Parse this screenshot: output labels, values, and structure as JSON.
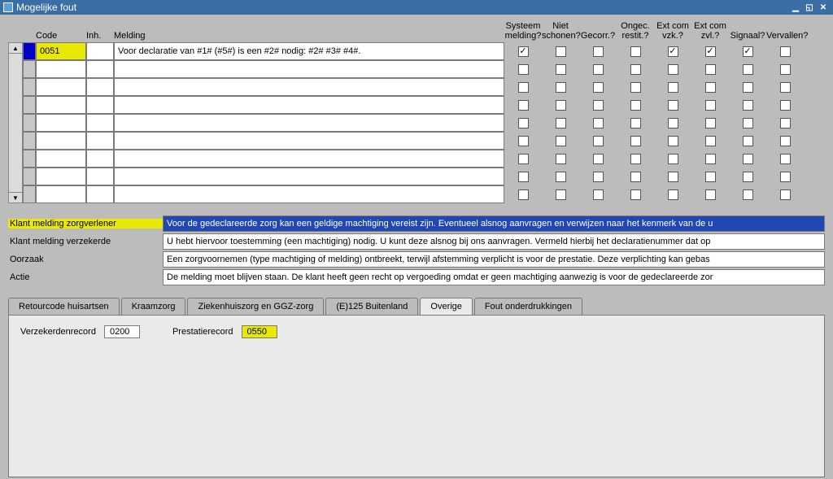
{
  "window": {
    "title": "Mogelijke fout"
  },
  "table": {
    "headers": {
      "code": "Code",
      "inh": "Inh.",
      "melding": "Melding",
      "c1a": "Systeem",
      "c1b": "melding?",
      "c2a": "Niet",
      "c2b": "schonen?",
      "c3a": "",
      "c3b": "Gecorr.?",
      "c4a": "Ongec.",
      "c4b": "restit.?",
      "c5a": "Ext com",
      "c5b": "vzk.?",
      "c6a": "Ext com",
      "c6b": "zvl.?",
      "c7a": "",
      "c7b": "Signaal?",
      "c8a": "",
      "c8b": "Vervallen?"
    },
    "rows": [
      {
        "code": "0051",
        "inh": "",
        "melding": "Voor declaratie van #1# (#5#) is een #2# nodig: #2# #3# #4#.",
        "checks": [
          true,
          false,
          false,
          false,
          true,
          true,
          true,
          false
        ]
      },
      {
        "code": "",
        "inh": "",
        "melding": "",
        "checks": [
          false,
          false,
          false,
          false,
          false,
          false,
          false,
          false
        ]
      },
      {
        "code": "",
        "inh": "",
        "melding": "",
        "checks": [
          false,
          false,
          false,
          false,
          false,
          false,
          false,
          false
        ]
      },
      {
        "code": "",
        "inh": "",
        "melding": "",
        "checks": [
          false,
          false,
          false,
          false,
          false,
          false,
          false,
          false
        ]
      },
      {
        "code": "",
        "inh": "",
        "melding": "",
        "checks": [
          false,
          false,
          false,
          false,
          false,
          false,
          false,
          false
        ]
      },
      {
        "code": "",
        "inh": "",
        "melding": "",
        "checks": [
          false,
          false,
          false,
          false,
          false,
          false,
          false,
          false
        ]
      },
      {
        "code": "",
        "inh": "",
        "melding": "",
        "checks": [
          false,
          false,
          false,
          false,
          false,
          false,
          false,
          false
        ]
      },
      {
        "code": "",
        "inh": "",
        "melding": "",
        "checks": [
          false,
          false,
          false,
          false,
          false,
          false,
          false,
          false
        ]
      },
      {
        "code": "",
        "inh": "",
        "melding": "",
        "checks": [
          false,
          false,
          false,
          false,
          false,
          false,
          false,
          false
        ]
      }
    ]
  },
  "detail": {
    "labels": {
      "kmz": "Klant melding zorgverlener",
      "kmv": "Klant melding verzekerde",
      "oorzaak": "Oorzaak",
      "actie": "Actie"
    },
    "values": {
      "kmz": "Voor de gedeclareerde zorg kan een geldige machtiging vereist zijn. Eventueel alsnog aanvragen en verwijzen naar het kenmerk van de u",
      "kmv": "U hebt hiervoor toestemming (een machtiging) nodig. U kunt deze alsnog bij ons aanvragen. Vermeld hierbij het declaratienummer dat op",
      "oorzaak": "Een zorgvoornemen (type machtiging of melding) ontbreekt, terwijl afstemming verplicht is voor de prestatie. Deze verplichting kan gebas",
      "actie": "De melding moet blijven staan. De klant heeft geen recht op vergoeding omdat er geen machtiging aanwezig is voor de gedeclareerde zor"
    }
  },
  "tabs": {
    "items": [
      "Retourcode huisartsen",
      "Kraamzorg",
      "Ziekenhuiszorg en GGZ-zorg",
      "(E)125 Buitenland",
      "Overige",
      "Fout onderdrukkingen"
    ],
    "activeIndex": 4,
    "panel": {
      "verzekerden_label": "Verzekerdenrecord",
      "verzekerden_value": "0200",
      "prestatie_label": "Prestatierecord",
      "prestatie_value": "0550"
    }
  }
}
